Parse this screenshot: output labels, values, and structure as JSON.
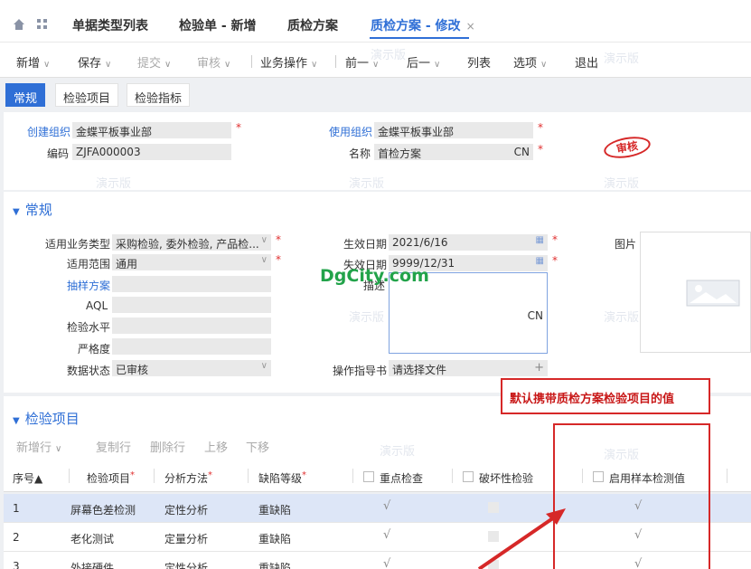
{
  "tabs": [
    {
      "label": "单据类型列表"
    },
    {
      "label": "检验单 - 新增"
    },
    {
      "label": "质检方案"
    },
    {
      "label": "质检方案 - 修改",
      "close": "×"
    }
  ],
  "toolbar": [
    {
      "label": "新增",
      "caret": "∨",
      "disabled": false
    },
    {
      "label": "保存",
      "caret": "∨",
      "disabled": false
    },
    {
      "label": "提交",
      "caret": "∨",
      "disabled": true
    },
    {
      "label": "审核",
      "caret": "∨",
      "disabled": true
    },
    {
      "label": "业务操作",
      "caret": "∨",
      "disabled": false
    },
    {
      "label": "前一",
      "caret": "∨",
      "disabled": false
    },
    {
      "label": "后一",
      "caret": "∨",
      "disabled": false
    },
    {
      "label": "列表",
      "caret": "",
      "disabled": false
    },
    {
      "label": "选项",
      "caret": "∨",
      "disabled": false
    },
    {
      "label": "退出",
      "caret": "",
      "disabled": false
    }
  ],
  "subtabs": [
    "常规",
    "检验项目",
    "检验指标"
  ],
  "header": {
    "create_org_label": "创建组织",
    "create_org_value": "金蝶平板事业部",
    "code_label": "编码",
    "code_value": "ZJFA000003",
    "use_org_label": "使用组织",
    "use_org_value": "金蝶平板事业部",
    "name_label": "名称",
    "name_value": "首检方案",
    "name_lang": "CN",
    "stamp": "审核",
    "required": "*"
  },
  "general": {
    "title": "常规",
    "biz_type_label": "适用业务类型",
    "biz_type_value": "采购检验, 委外检验, 产品检...",
    "scope_label": "适用范围",
    "scope_value": "通用",
    "sampling_label": "抽样方案",
    "aql_label": "AQL",
    "level_label": "检验水平",
    "strict_label": "严格度",
    "status_label": "数据状态",
    "status_value": "已审核",
    "eff_date_label": "生效日期",
    "eff_date_value": "2021/6/16",
    "exp_date_label": "失效日期",
    "exp_date_value": "9999/12/31",
    "desc_label": "描述",
    "desc_lang": "CN",
    "guide_label": "操作指导书",
    "guide_value": "请选择文件",
    "guide_add": "+",
    "image_label": "图片"
  },
  "items": {
    "title": "检验项目",
    "actions": [
      {
        "label": "新增行",
        "caret": "∨"
      },
      {
        "label": "复制行",
        "caret": ""
      },
      {
        "label": "删除行",
        "caret": ""
      },
      {
        "label": "上移",
        "caret": ""
      },
      {
        "label": "下移",
        "caret": ""
      }
    ],
    "columns": [
      "序号▲",
      "检验项目",
      "分析方法",
      "缺陷等级",
      "重点检查",
      "破坏性检验",
      "启用样本检测值"
    ],
    "rows": [
      {
        "no": "1",
        "item": "屏幕色差检测",
        "method": "定性分析",
        "level": "重缺陷",
        "key": "√",
        "sample": "√"
      },
      {
        "no": "2",
        "item": "老化测试",
        "method": "定量分析",
        "level": "重缺陷",
        "key": "√",
        "sample": "√"
      },
      {
        "no": "3",
        "item": "外接硬件",
        "method": "定性分析",
        "level": "重缺陷",
        "key": "√",
        "sample": "√"
      }
    ]
  },
  "watermark": "演示版",
  "brand": "DgCity.com",
  "callout": "默认携带质检方案检验项目的值",
  "colors": {
    "accent": "#2f6fd6",
    "highlight": "#d62828",
    "brand": "#22a34a"
  }
}
